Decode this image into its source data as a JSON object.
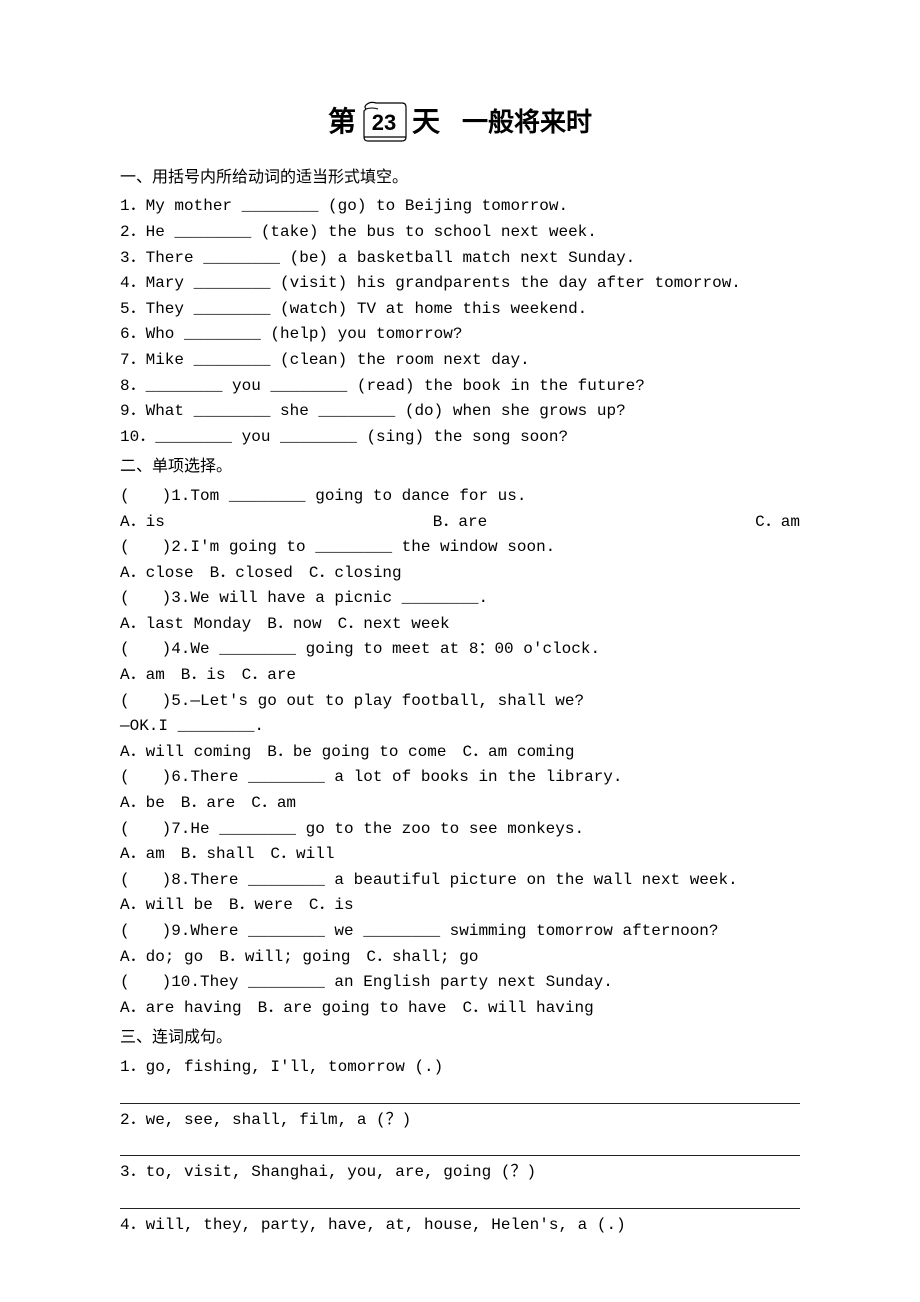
{
  "title": {
    "prefix": "第",
    "number": "23",
    "day": "天",
    "subtitle": "一般将来时"
  },
  "section1": {
    "heading": "一、用括号内所给动词的适当形式填空。",
    "items": [
      "1．My mother ________ (go) to Beijing tomorrow.",
      "2．He ________ (take) the bus to school next week.",
      "3．There ________ (be) a basketball match next Sunday.",
      "4．Mary ________ (visit) his grandparents the day after tomorrow.",
      "5．They ________ (watch) TV at home this weekend.",
      "6．Who ________ (help) you tomorrow?",
      "7．Mike ________ (clean) the room next day.",
      "8．________ you ________ (read) the book in the future?",
      "9．What ________ she ________ (do) when she grows up?",
      "10．________ you ________ (sing) the song soon?"
    ]
  },
  "section2": {
    "heading": "二、单项选择。",
    "items": [
      {
        "stem": "(　　)1.Tom ________ going to dance for us.",
        "wide": true,
        "opts": [
          "A．is",
          "B．are",
          "C．am"
        ]
      },
      {
        "stem": "(　　)2.I'm going to ________ the window soon.",
        "opts_inline": "A．close　B．closed　C．closing"
      },
      {
        "stem": "(　　)3.We will have a picnic ________.",
        "opts_inline": "A．last Monday　B．now　C．next week"
      },
      {
        "stem": "(　　)4.We ________ going to meet at 8：00 o'clock.",
        "opts_inline": "A．am　B．is　C．are"
      },
      {
        "stem": "(　　)5.—Let's go out to play football, shall we?",
        "stem2": "—OK.I ________.",
        "opts_inline": "A．will coming　B．be going to come　C．am coming"
      },
      {
        "stem": "(　　)6.There ________ a lot of books in the library.",
        "opts_inline": "A．be　B．are　C．am"
      },
      {
        "stem": "(　　)7.He ________ go to the zoo to see monkeys.",
        "opts_inline": "A．am　B．shall　C．will"
      },
      {
        "stem": "(　　)8.There ________ a beautiful picture on the wall next week.",
        "opts_inline": "A．will be　B．were　C．is"
      },
      {
        "stem": "(　　)9.Where ________ we ________ swimming tomorrow afternoon?",
        "opts_inline": "A．do; go　B．will; going　C．shall; go"
      },
      {
        "stem": "(　　)10.They ________ an English party next Sunday.",
        "opts_inline": "A．are having　B．are going to have　C．will having"
      }
    ]
  },
  "section3": {
    "heading": "三、连词成句。",
    "items": [
      "1．go, fishing, I'll, tomorrow (.)",
      "2．we, see, shall, film, a (？)",
      "3．to, visit, Shanghai, you, are, going (？)",
      "4．will, they, party, have, at, house, Helen's, a (.)"
    ]
  }
}
